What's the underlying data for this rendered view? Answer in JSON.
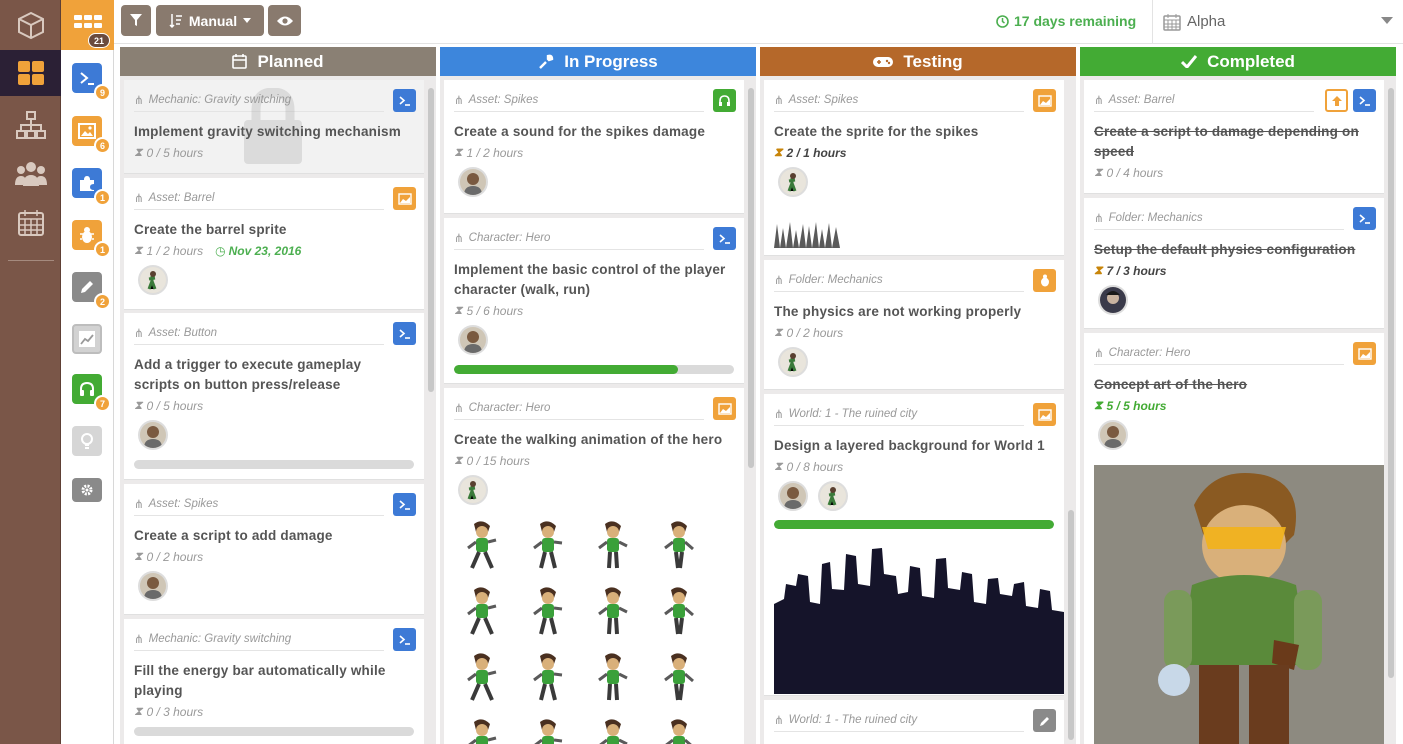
{
  "sidebar": {
    "items": [
      {
        "name": "box-icon",
        "active": false
      },
      {
        "name": "board-icon",
        "active": true
      },
      {
        "name": "hierarchy-icon",
        "active": false
      },
      {
        "name": "team-icon",
        "active": false
      },
      {
        "name": "calendar-icon",
        "active": false
      }
    ]
  },
  "filters": {
    "top_count": "21",
    "items": [
      {
        "name": "script-filter",
        "color": "#3d7ad6",
        "badge": "9"
      },
      {
        "name": "image-filter",
        "color": "#f0a23a",
        "badge": "6"
      },
      {
        "name": "puzzle-filter",
        "color": "#3d7ad6",
        "badge": "1"
      },
      {
        "name": "bug-filter",
        "color": "#f0a23a",
        "badge": "1"
      },
      {
        "name": "pencil-filter",
        "color": "#8a8a8a",
        "badge": "2"
      },
      {
        "name": "chart-filter",
        "color": "#c8c8c8",
        "badge": ""
      },
      {
        "name": "sound-filter",
        "color": "#43ab34",
        "badge": "7"
      },
      {
        "name": "idea-filter",
        "color": "#c8c8c8",
        "badge": ""
      },
      {
        "name": "settings-filter",
        "color": "#8a8a8a",
        "badge": ""
      }
    ]
  },
  "toolbar": {
    "sort_label": "Manual",
    "remaining": "17 days remaining",
    "version": "Alpha"
  },
  "columns": [
    {
      "title": "Planned",
      "color": "#8a8074",
      "cards": [
        {
          "category": "Mechanic: Gravity switching",
          "title": "Implement gravity switching mechanism",
          "hours": "0 / 5 hours",
          "type": "script"
        },
        {
          "category": "Asset: Barrel",
          "title": "Create the barrel sprite",
          "hours": "1 / 2 hours",
          "date": "Nov 23, 2016",
          "type": "image"
        },
        {
          "category": "Asset: Button",
          "title": "Add a trigger to execute gameplay scripts on button press/release",
          "hours": "0 / 5 hours",
          "type": "script"
        },
        {
          "category": "Asset: Spikes",
          "title": "Create a script to add damage",
          "hours": "0 / 2 hours",
          "type": "script"
        },
        {
          "category": "Mechanic: Gravity switching",
          "title": "Fill the energy bar automatically while playing",
          "hours": "0 / 3 hours",
          "type": "script"
        }
      ]
    },
    {
      "title": "In Progress",
      "color": "#3d86dc",
      "cards": [
        {
          "category": "Asset: Spikes",
          "title": "Create a sound for the spikes damage",
          "hours": "1 / 2 hours",
          "type": "sound"
        },
        {
          "category": "Character: Hero",
          "title": "Implement the basic control of the player character (walk, run)",
          "hours": "5 / 6 hours",
          "progress": 0.8,
          "type": "script"
        },
        {
          "category": "Character: Hero",
          "title": "Create the walking animation of the hero",
          "hours": "0 / 15 hours",
          "type": "image"
        }
      ]
    },
    {
      "title": "Testing",
      "color": "#b5682a",
      "cards": [
        {
          "category": "Asset: Spikes",
          "title": "Create the sprite for the spikes",
          "hours": "2 / 1 hours",
          "type": "image"
        },
        {
          "category": "Folder: Mechanics",
          "title": "The physics are not working properly",
          "hours": "0 / 2 hours",
          "type": "bug"
        },
        {
          "category": "World: 1 - The ruined city",
          "title": "Design a layered background for World 1",
          "hours": "0 / 8 hours",
          "progress": 1.0,
          "type": "image"
        },
        {
          "category": "World: 1 - The ruined city",
          "title": "",
          "hours": "",
          "type": "pencil"
        }
      ]
    },
    {
      "title": "Completed",
      "color": "#43ab34",
      "cards": [
        {
          "category": "Asset: Barrel",
          "title": "Create a script to damage depending on speed",
          "hours": "0 / 4 hours",
          "type": "script"
        },
        {
          "category": "Folder: Mechanics",
          "title": "Setup the default physics configuration",
          "hours": "7 / 3 hours",
          "type": "script"
        },
        {
          "category": "Character: Hero",
          "title": "Concept art of the hero",
          "hours": "5 / 5 hours",
          "type": "image"
        }
      ]
    }
  ]
}
